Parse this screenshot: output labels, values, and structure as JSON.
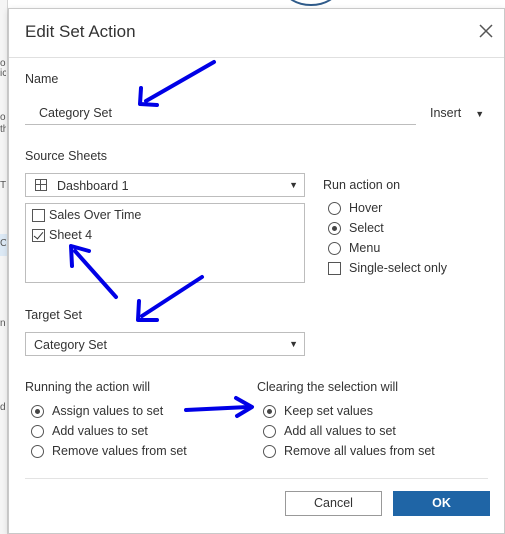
{
  "background": {
    "fragments": [
      "o",
      "ic",
      "o",
      "th",
      "T",
      "C",
      "n",
      "d"
    ]
  },
  "dialog": {
    "title": "Edit Set Action",
    "name_label": "Name",
    "name_value": "Category Set",
    "insert_label": "Insert",
    "source_sheets_label": "Source Sheets",
    "source_dropdown_value": "Dashboard 1",
    "sheets": [
      {
        "label": "Sales Over Time",
        "checked": false
      },
      {
        "label": "Sheet 4",
        "checked": true
      }
    ],
    "run_action_label": "Run action on",
    "run_action_options": [
      {
        "label": "Hover",
        "selected": false
      },
      {
        "label": "Select",
        "selected": true
      },
      {
        "label": "Menu",
        "selected": false
      }
    ],
    "single_select_label": "Single-select only",
    "single_select_checked": false,
    "target_set_label": "Target Set",
    "target_set_value": "Category Set",
    "running_label": "Running the action will",
    "running_options": [
      {
        "label": "Assign values to set",
        "selected": true
      },
      {
        "label": "Add values to set",
        "selected": false
      },
      {
        "label": "Remove values from set",
        "selected": false
      }
    ],
    "clearing_label": "Clearing the selection will",
    "clearing_options": [
      {
        "label": "Keep set values",
        "selected": true
      },
      {
        "label": "Add all values to set",
        "selected": false
      },
      {
        "label": "Remove all values from set",
        "selected": false
      }
    ],
    "cancel_label": "Cancel",
    "ok_label": "OK"
  },
  "colors": {
    "ok_button": "#1f65a6",
    "annotation_arrow": "#0000e6"
  }
}
